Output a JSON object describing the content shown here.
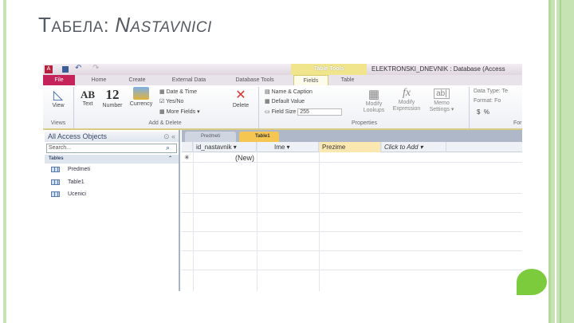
{
  "slide": {
    "title_prefix": "Т",
    "title_rest": "АБЕЛА",
    "colon": ": ",
    "title2_prefix": "N",
    "title2_rest": "ASTAVNICI"
  },
  "access": {
    "window_title": "ELEKTRONSKI_DNEVNIK : Database (Access",
    "contextual_tab": "Table Tools",
    "tabs": [
      "File",
      "Home",
      "Create",
      "External Data",
      "Database Tools",
      "Fields",
      "Table"
    ],
    "ribbon": {
      "view": "View",
      "views_group": "Views",
      "text": "Text",
      "text_icon": "AB",
      "number": "Number",
      "number_icon": "12",
      "currency": "Currency",
      "date_time": "Date & Time",
      "yes_no": "Yes/No",
      "more_fields": "More Fields ▾",
      "delete": "Delete",
      "add_delete_group": "Add & Delete",
      "name_caption": "Name & Caption",
      "default_value": "Default Value",
      "field_size_label": "Field Size",
      "field_size_value": "255",
      "modify_lookups": "Modify Lookups",
      "modify_expression": "Modify Expression",
      "memo_settings": "Memo Settings ▾",
      "properties_group": "Properties",
      "data_type_label": "Data Type:",
      "data_type_value": "Te",
      "format_label": "Format:",
      "format_value": "Fo",
      "currency_sym": "$",
      "percent_sym": "%",
      "formatting_group": "For"
    },
    "nav": {
      "header": "All Access Objects",
      "search_placeholder": "Search...",
      "section": "Tables",
      "items": [
        "Predmeti",
        "Table1",
        "Ucenici"
      ]
    },
    "datasheet": {
      "doc_tabs": [
        "Predmeti",
        "Table1"
      ],
      "columns": [
        "id_nastavnik ▾",
        "Ime ▾",
        "Prezime",
        "Click to Add ▾"
      ],
      "new_row": "(New)",
      "new_marker": "✳"
    }
  }
}
